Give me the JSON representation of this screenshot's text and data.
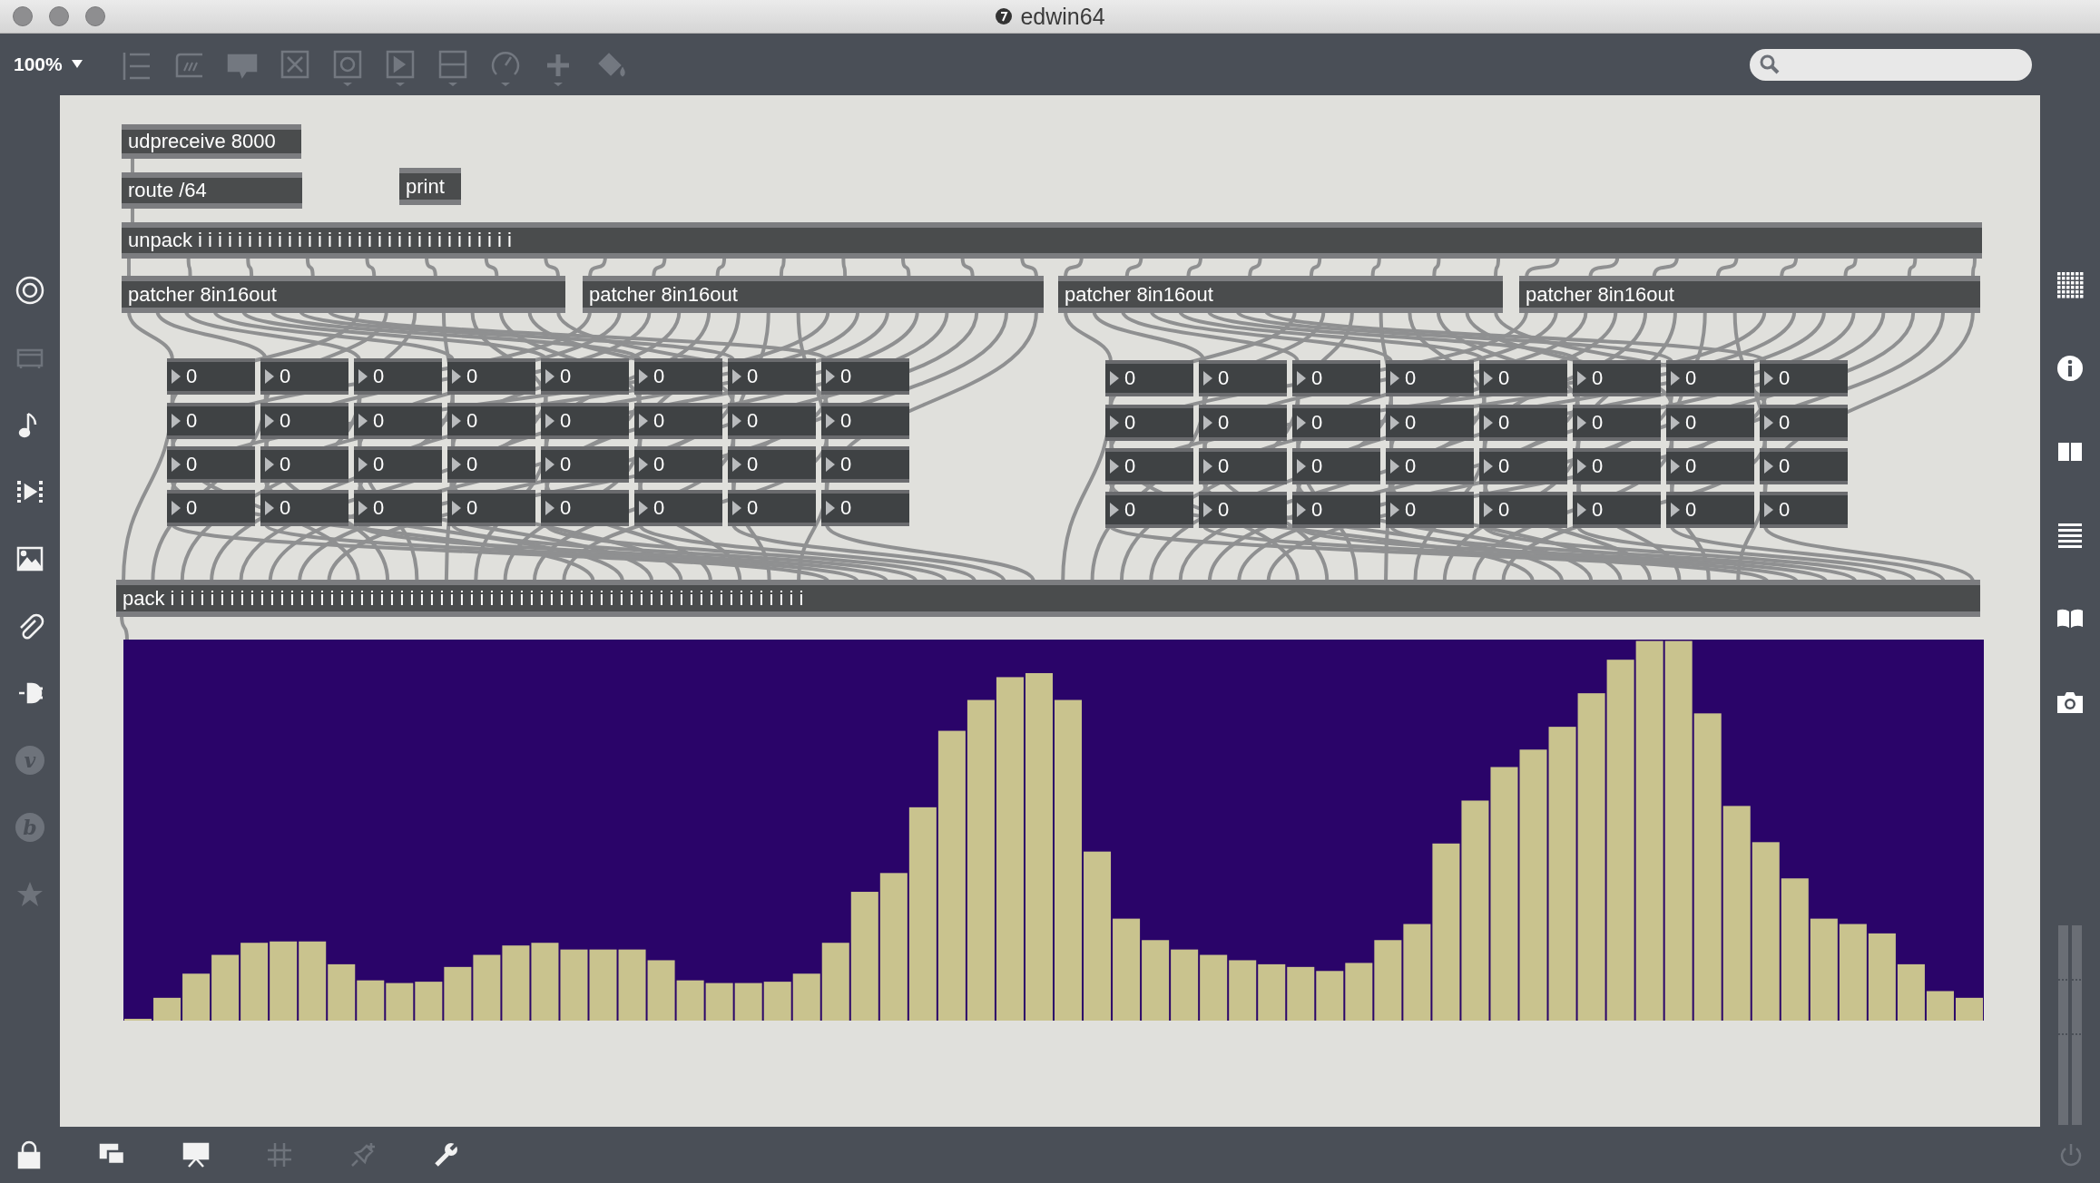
{
  "window": {
    "title": "edwin64"
  },
  "toolbar": {
    "zoom": "100%",
    "tools": [
      {
        "kind": "list",
        "disabled": true
      },
      {
        "kind": "message",
        "disabled": true
      },
      {
        "kind": "comment",
        "disabled": true
      },
      {
        "kind": "toggle",
        "disabled": true
      },
      {
        "kind": "button",
        "disabled": true
      },
      {
        "kind": "play",
        "disabled": true
      },
      {
        "kind": "slider",
        "disabled": true
      },
      {
        "kind": "dial",
        "disabled": true
      },
      {
        "kind": "plus",
        "disabled": true
      },
      {
        "kind": "bucket",
        "disabled": true
      }
    ]
  },
  "left_sidebar": [
    {
      "kind": "target",
      "disabled": false
    },
    {
      "kind": "presentation",
      "disabled": true
    },
    {
      "kind": "note",
      "disabled": false
    },
    {
      "kind": "video",
      "disabled": false
    },
    {
      "kind": "image",
      "disabled": false
    },
    {
      "kind": "clip",
      "disabled": false
    },
    {
      "kind": "plug",
      "disabled": false
    },
    {
      "kind": "letter",
      "letter": "v",
      "disabled": true
    },
    {
      "kind": "letter",
      "letter": "b",
      "disabled": true
    },
    {
      "kind": "star",
      "disabled": true
    }
  ],
  "right_sidebar": [
    {
      "kind": "grid"
    },
    {
      "kind": "info"
    },
    {
      "kind": "columns"
    },
    {
      "kind": "list"
    },
    {
      "kind": "book"
    },
    {
      "kind": "camera"
    }
  ],
  "objects": [
    {
      "text": "udpreceive 8000"
    },
    {
      "text": "route /64"
    },
    {
      "text": "print"
    },
    {
      "text": "unpack i i i i i i i i i i i i i i i i i i i i i i i i i i i i i i i i"
    },
    {
      "text": "patcher 8in16out"
    },
    {
      "text": "patcher 8in16out"
    },
    {
      "text": "patcher 8in16out"
    },
    {
      "text": "patcher 8in16out"
    },
    {
      "text": "pack i i i i i i i i i i i i i i i i i i i i i i i i i i i i i i i i i i i i i i i i i i i i i i i i i i i i i i i i i i i i i i i i"
    }
  ],
  "number_groups": [
    {
      "rows": [
        [
          "0",
          "0",
          "0",
          "0",
          "0",
          "0",
          "0",
          "0"
        ],
        [
          "0",
          "0",
          "0",
          "0",
          "0",
          "0",
          "0",
          "0"
        ],
        [
          "0",
          "0",
          "0",
          "0",
          "0",
          "0",
          "0",
          "0"
        ],
        [
          "0",
          "0",
          "0",
          "0",
          "0",
          "0",
          "0",
          "0"
        ]
      ]
    },
    {
      "rows": [
        [
          "0",
          "0",
          "0",
          "0",
          "0",
          "0",
          "0",
          "0"
        ],
        [
          "0",
          "0",
          "0",
          "0",
          "0",
          "0",
          "0",
          "0"
        ],
        [
          "0",
          "0",
          "0",
          "0",
          "0",
          "0",
          "0",
          "0"
        ],
        [
          "0",
          "0",
          "0",
          "0",
          "0",
          "0",
          "0",
          "0"
        ]
      ]
    }
  ],
  "bottom_bar": [
    {
      "kind": "lock",
      "disabled": false
    },
    {
      "kind": "windows",
      "disabled": false
    },
    {
      "kind": "presentation",
      "disabled": false
    },
    {
      "kind": "grid",
      "disabled": true
    },
    {
      "kind": "pin",
      "disabled": true
    },
    {
      "kind": "wrench",
      "disabled": false
    }
  ]
}
